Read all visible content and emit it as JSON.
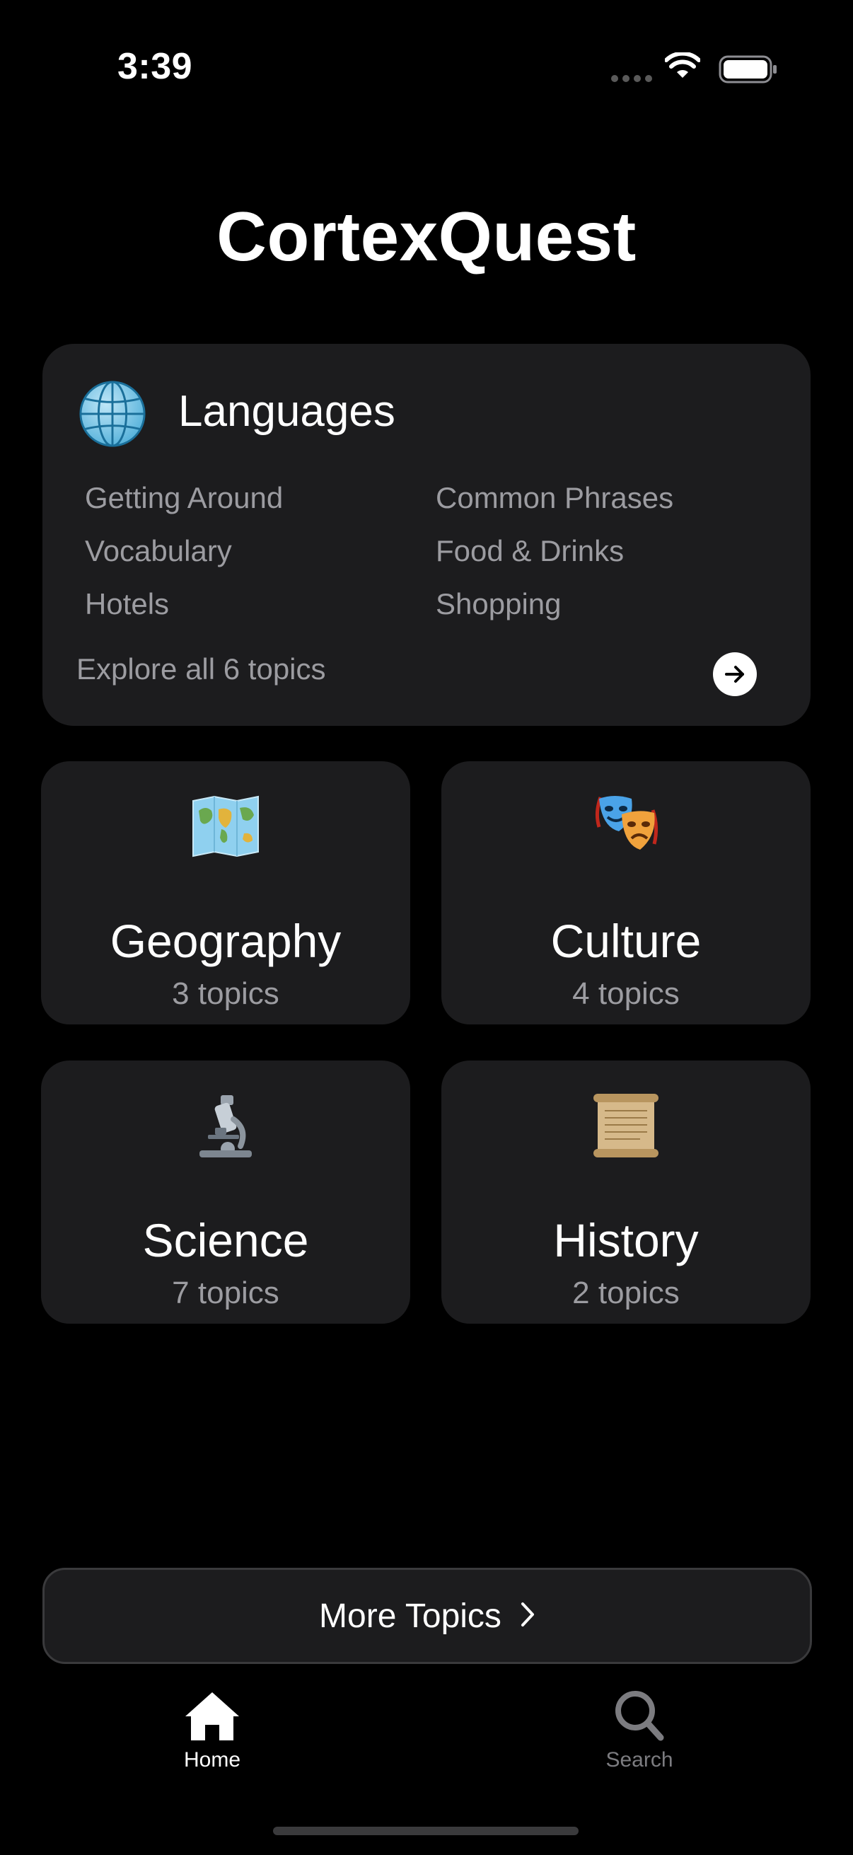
{
  "status_bar": {
    "time": "3:39"
  },
  "app": {
    "title": "CortexQuest"
  },
  "languages": {
    "title": "Languages",
    "icon": "globe-icon",
    "topics": [
      "Getting Around",
      "Common Phrases",
      "Vocabulary",
      "Food & Drinks",
      "Hotels",
      "Shopping"
    ],
    "explore_label": "Explore all 6 topics"
  },
  "categories": [
    {
      "name": "Geography",
      "count": "3 topics",
      "icon": "world-map-icon"
    },
    {
      "name": "Culture",
      "count": "4 topics",
      "icon": "performing-arts-icon"
    },
    {
      "name": "Science",
      "count": "7 topics",
      "icon": "microscope-icon"
    },
    {
      "name": "History",
      "count": "2 topics",
      "icon": "scroll-icon"
    }
  ],
  "more_topics": {
    "label": "More Topics"
  },
  "tab_bar": {
    "tabs": [
      {
        "label": "Home",
        "icon": "house-icon",
        "active": true
      },
      {
        "label": "Search",
        "icon": "magnifier-icon",
        "active": false
      }
    ]
  },
  "colors": {
    "background": "#000000",
    "card": "#1c1c1e",
    "secondary_text": "#9c9ca1",
    "inactive_tab": "#7c7c80"
  }
}
